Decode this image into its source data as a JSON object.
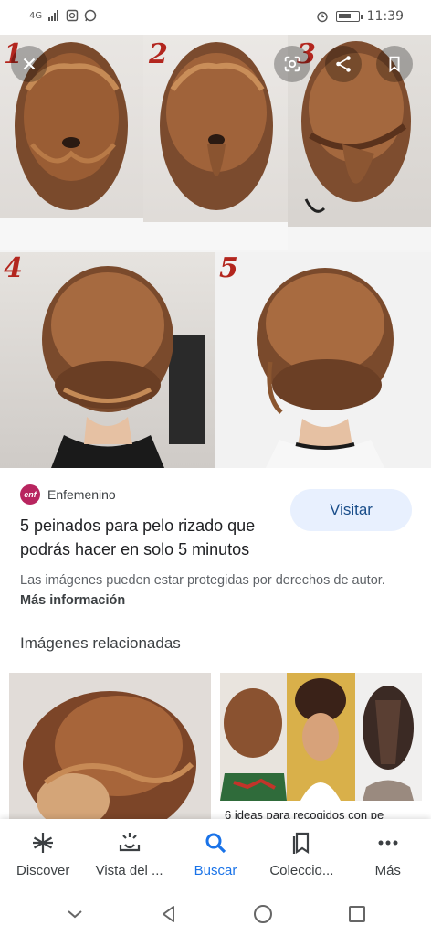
{
  "status_bar": {
    "network": "4G",
    "time": "11:39",
    "battery_level": 0.55
  },
  "main_image": {
    "steps": [
      "1",
      "2",
      "3",
      "4",
      "5"
    ]
  },
  "overlay": {
    "close_icon": "close-icon",
    "lens_icon": "lens-icon",
    "share_icon": "share-icon",
    "bookmark_icon": "bookmark-icon"
  },
  "source": {
    "favicon_text": "enf",
    "name": "Enfemenino",
    "title": "5 peinados para pelo rizado que podrás hacer en solo 5 minutos",
    "visit_label": "Visitar",
    "copyright_text": "Las imágenes pueden estar protegidas por derechos de autor.",
    "more_info_label": "Más información"
  },
  "related": {
    "heading": "Imágenes relacionadas",
    "right_caption": "6 ideas para recogidos con pe"
  },
  "bottom_nav": {
    "items": [
      {
        "label": "Discover",
        "icon": "asterisk-icon"
      },
      {
        "label": "Vista del ...",
        "icon": "snapshot-icon"
      },
      {
        "label": "Buscar",
        "icon": "search-icon"
      },
      {
        "label": "Coleccio...",
        "icon": "collections-icon"
      },
      {
        "label": "Más",
        "icon": "more-icon"
      }
    ]
  },
  "colors": {
    "accent": "#1a73e8",
    "visit_bg": "#e8f0fe",
    "step_number": "#b3261e"
  }
}
